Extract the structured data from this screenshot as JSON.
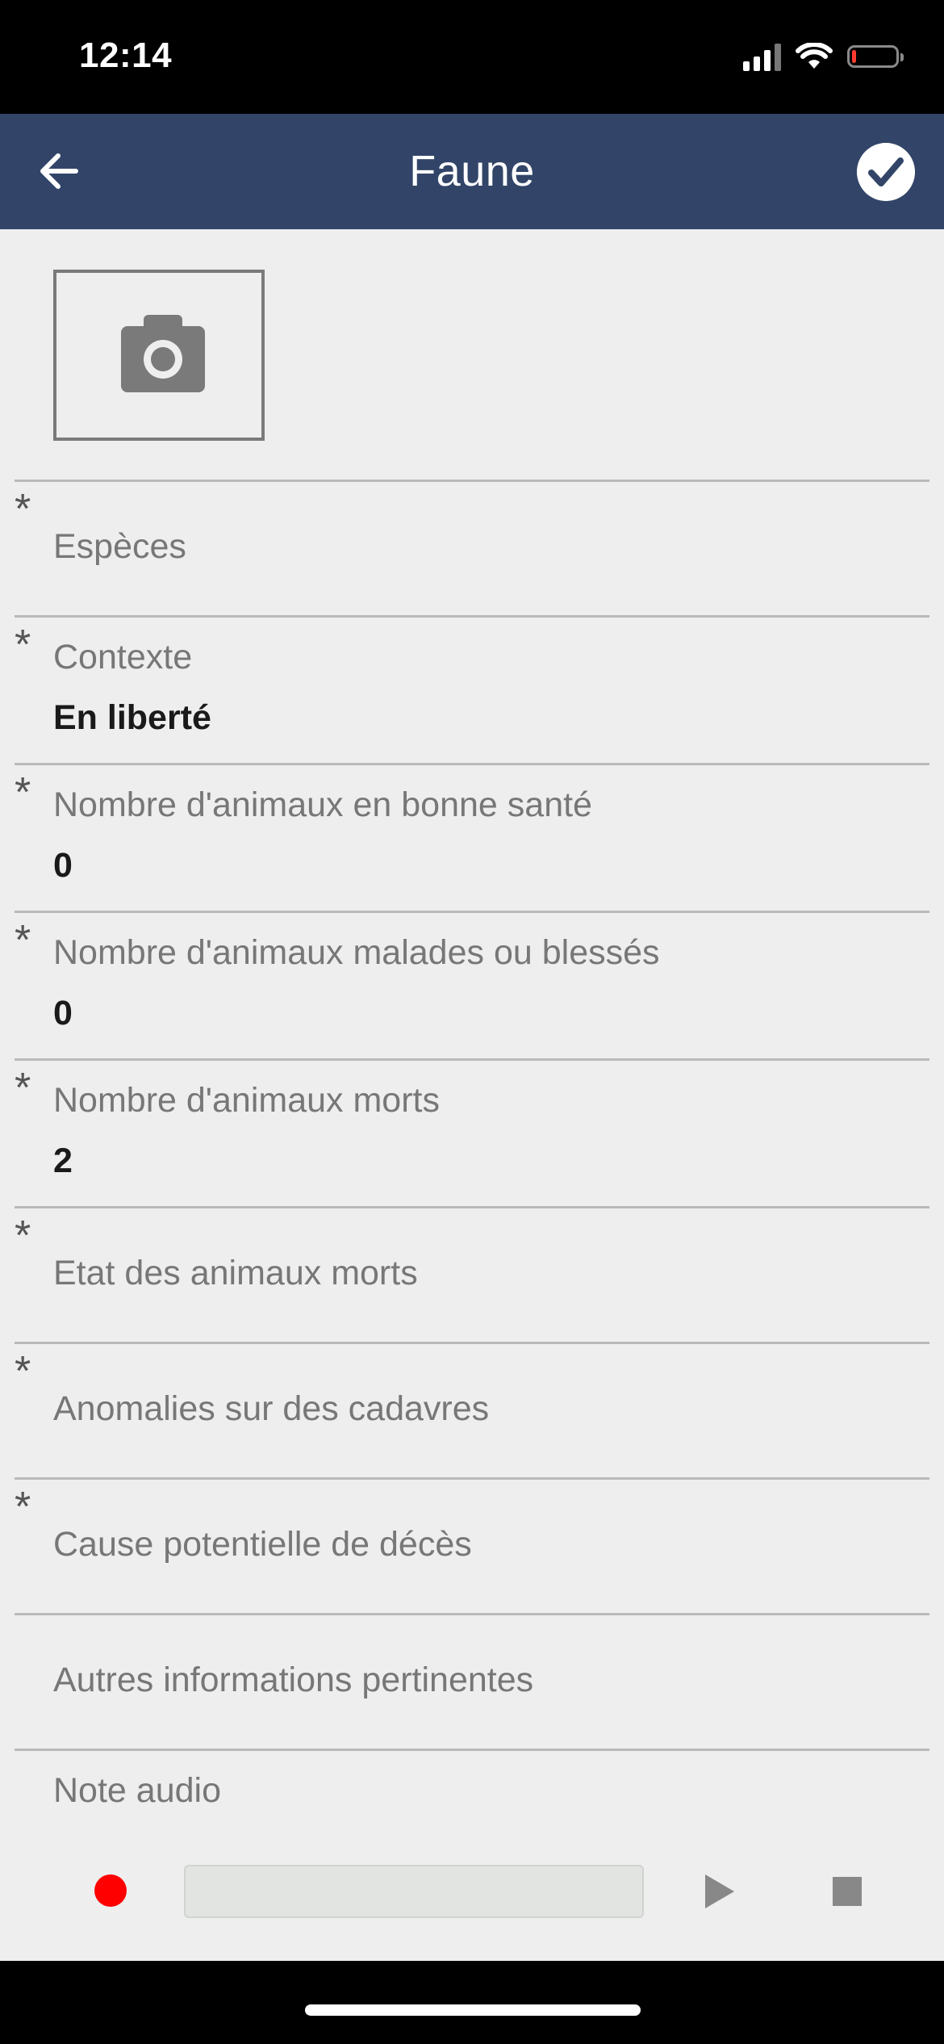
{
  "status_bar": {
    "time": "12:14",
    "icons": [
      "signal-icon",
      "wifi-icon",
      "battery-icon"
    ],
    "battery_color": "#ff3b30"
  },
  "header": {
    "title": "Faune",
    "back_icon": "arrow-left-icon",
    "confirm_icon": "checkmark-circle-icon",
    "background": "#324568"
  },
  "photo": {
    "icon": "camera-icon"
  },
  "form": {
    "required_marker": "*",
    "fields": [
      {
        "label": "Espèces",
        "value": "",
        "required": true
      },
      {
        "label": "Contexte",
        "value": "En liberté",
        "required": true
      },
      {
        "label": "Nombre d'animaux en bonne santé",
        "value": "0",
        "required": true
      },
      {
        "label": "Nombre d'animaux malades ou blessés",
        "value": "0",
        "required": true
      },
      {
        "label": "Nombre d'animaux morts",
        "value": "2",
        "required": true
      },
      {
        "label": "Etat des animaux morts",
        "value": "",
        "required": true
      },
      {
        "label": "Anomalies sur des cadavres",
        "value": "",
        "required": true
      },
      {
        "label": "Cause potentielle de décès",
        "value": "",
        "required": true
      },
      {
        "label": "Autres informations pertinentes",
        "value": "",
        "required": false
      }
    ]
  },
  "audio": {
    "label": "Note audio",
    "record_color": "#ff0000",
    "progress": 0
  }
}
